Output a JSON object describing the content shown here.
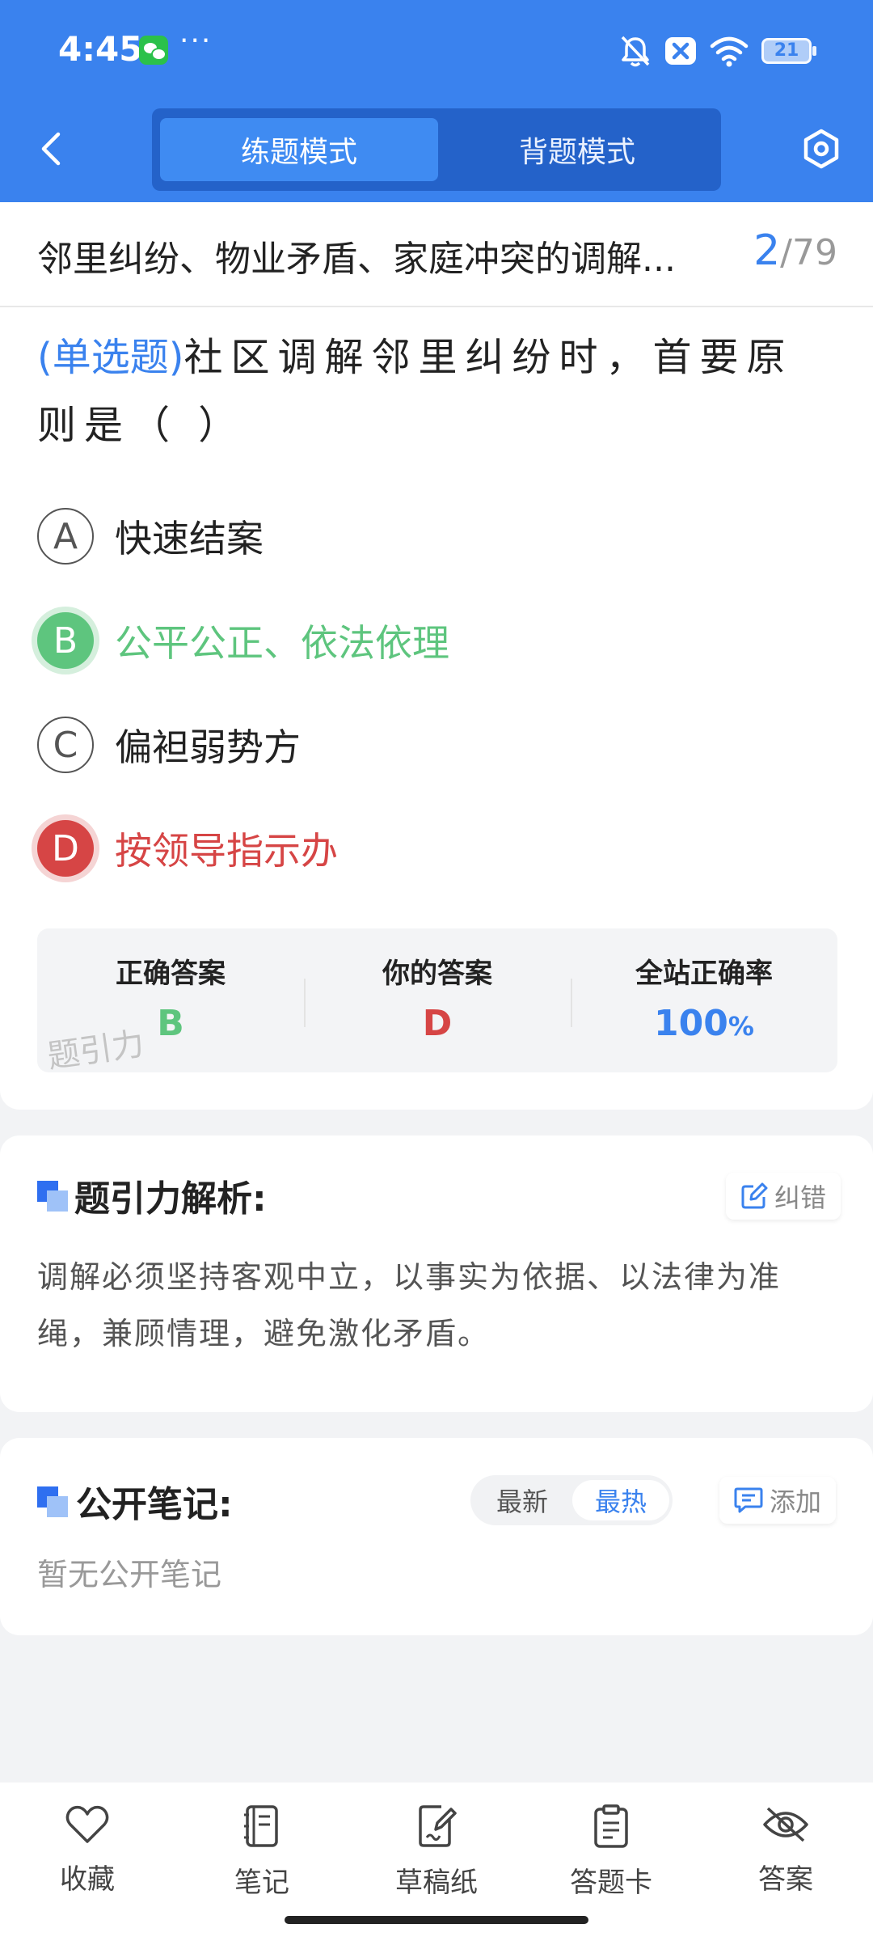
{
  "status_bar": {
    "time": "4:45",
    "more": "···",
    "battery": "21"
  },
  "nav": {
    "tabs": [
      {
        "label": "练题模式",
        "active": true
      },
      {
        "label": "背题模式",
        "active": false
      }
    ]
  },
  "question": {
    "title": "邻里纠纷、物业矛盾、家庭冲突的调解...",
    "current": "2",
    "separator": "/",
    "total": "79",
    "type": "(单选题)",
    "stem": "社区调解邻里纠纷时，首要原则是（    ）",
    "options": [
      {
        "letter": "A",
        "text": "快速结案",
        "state": "normal"
      },
      {
        "letter": "B",
        "text": "公平公正、依法依理",
        "state": "correct"
      },
      {
        "letter": "C",
        "text": "偏袒弱势方",
        "state": "normal"
      },
      {
        "letter": "D",
        "text": "按领导指示办",
        "state": "wrong"
      }
    ]
  },
  "answer_summary": {
    "correct_label": "正确答案",
    "correct_value": "B",
    "yours_label": "你的答案",
    "yours_value": "D",
    "rate_label": "全站正确率",
    "rate_value": "100",
    "rate_unit": "%",
    "watermark": "题引力",
    "colors": {
      "correct": "#5ec57e",
      "wrong": "#d64545",
      "accent": "#3a82ee"
    }
  },
  "analysis": {
    "title": "题引力解析:",
    "report_label": "纠错",
    "text": "调解必须坚持客观中立，以事实为依据、以法律为准绳，兼顾情理，避免激化矛盾。"
  },
  "notes": {
    "title": "公开笔记:",
    "sort": [
      {
        "label": "最新",
        "active": false
      },
      {
        "label": "最热",
        "active": true
      }
    ],
    "add_label": "添加",
    "empty_text": "暂无公开笔记"
  },
  "bottom_bar": [
    {
      "label": "收藏",
      "icon": "heart-icon"
    },
    {
      "label": "笔记",
      "icon": "notebook-icon"
    },
    {
      "label": "草稿纸",
      "icon": "draft-paper-icon"
    },
    {
      "label": "答题卡",
      "icon": "answer-sheet-icon"
    },
    {
      "label": "答案",
      "icon": "eye-off-icon"
    }
  ]
}
